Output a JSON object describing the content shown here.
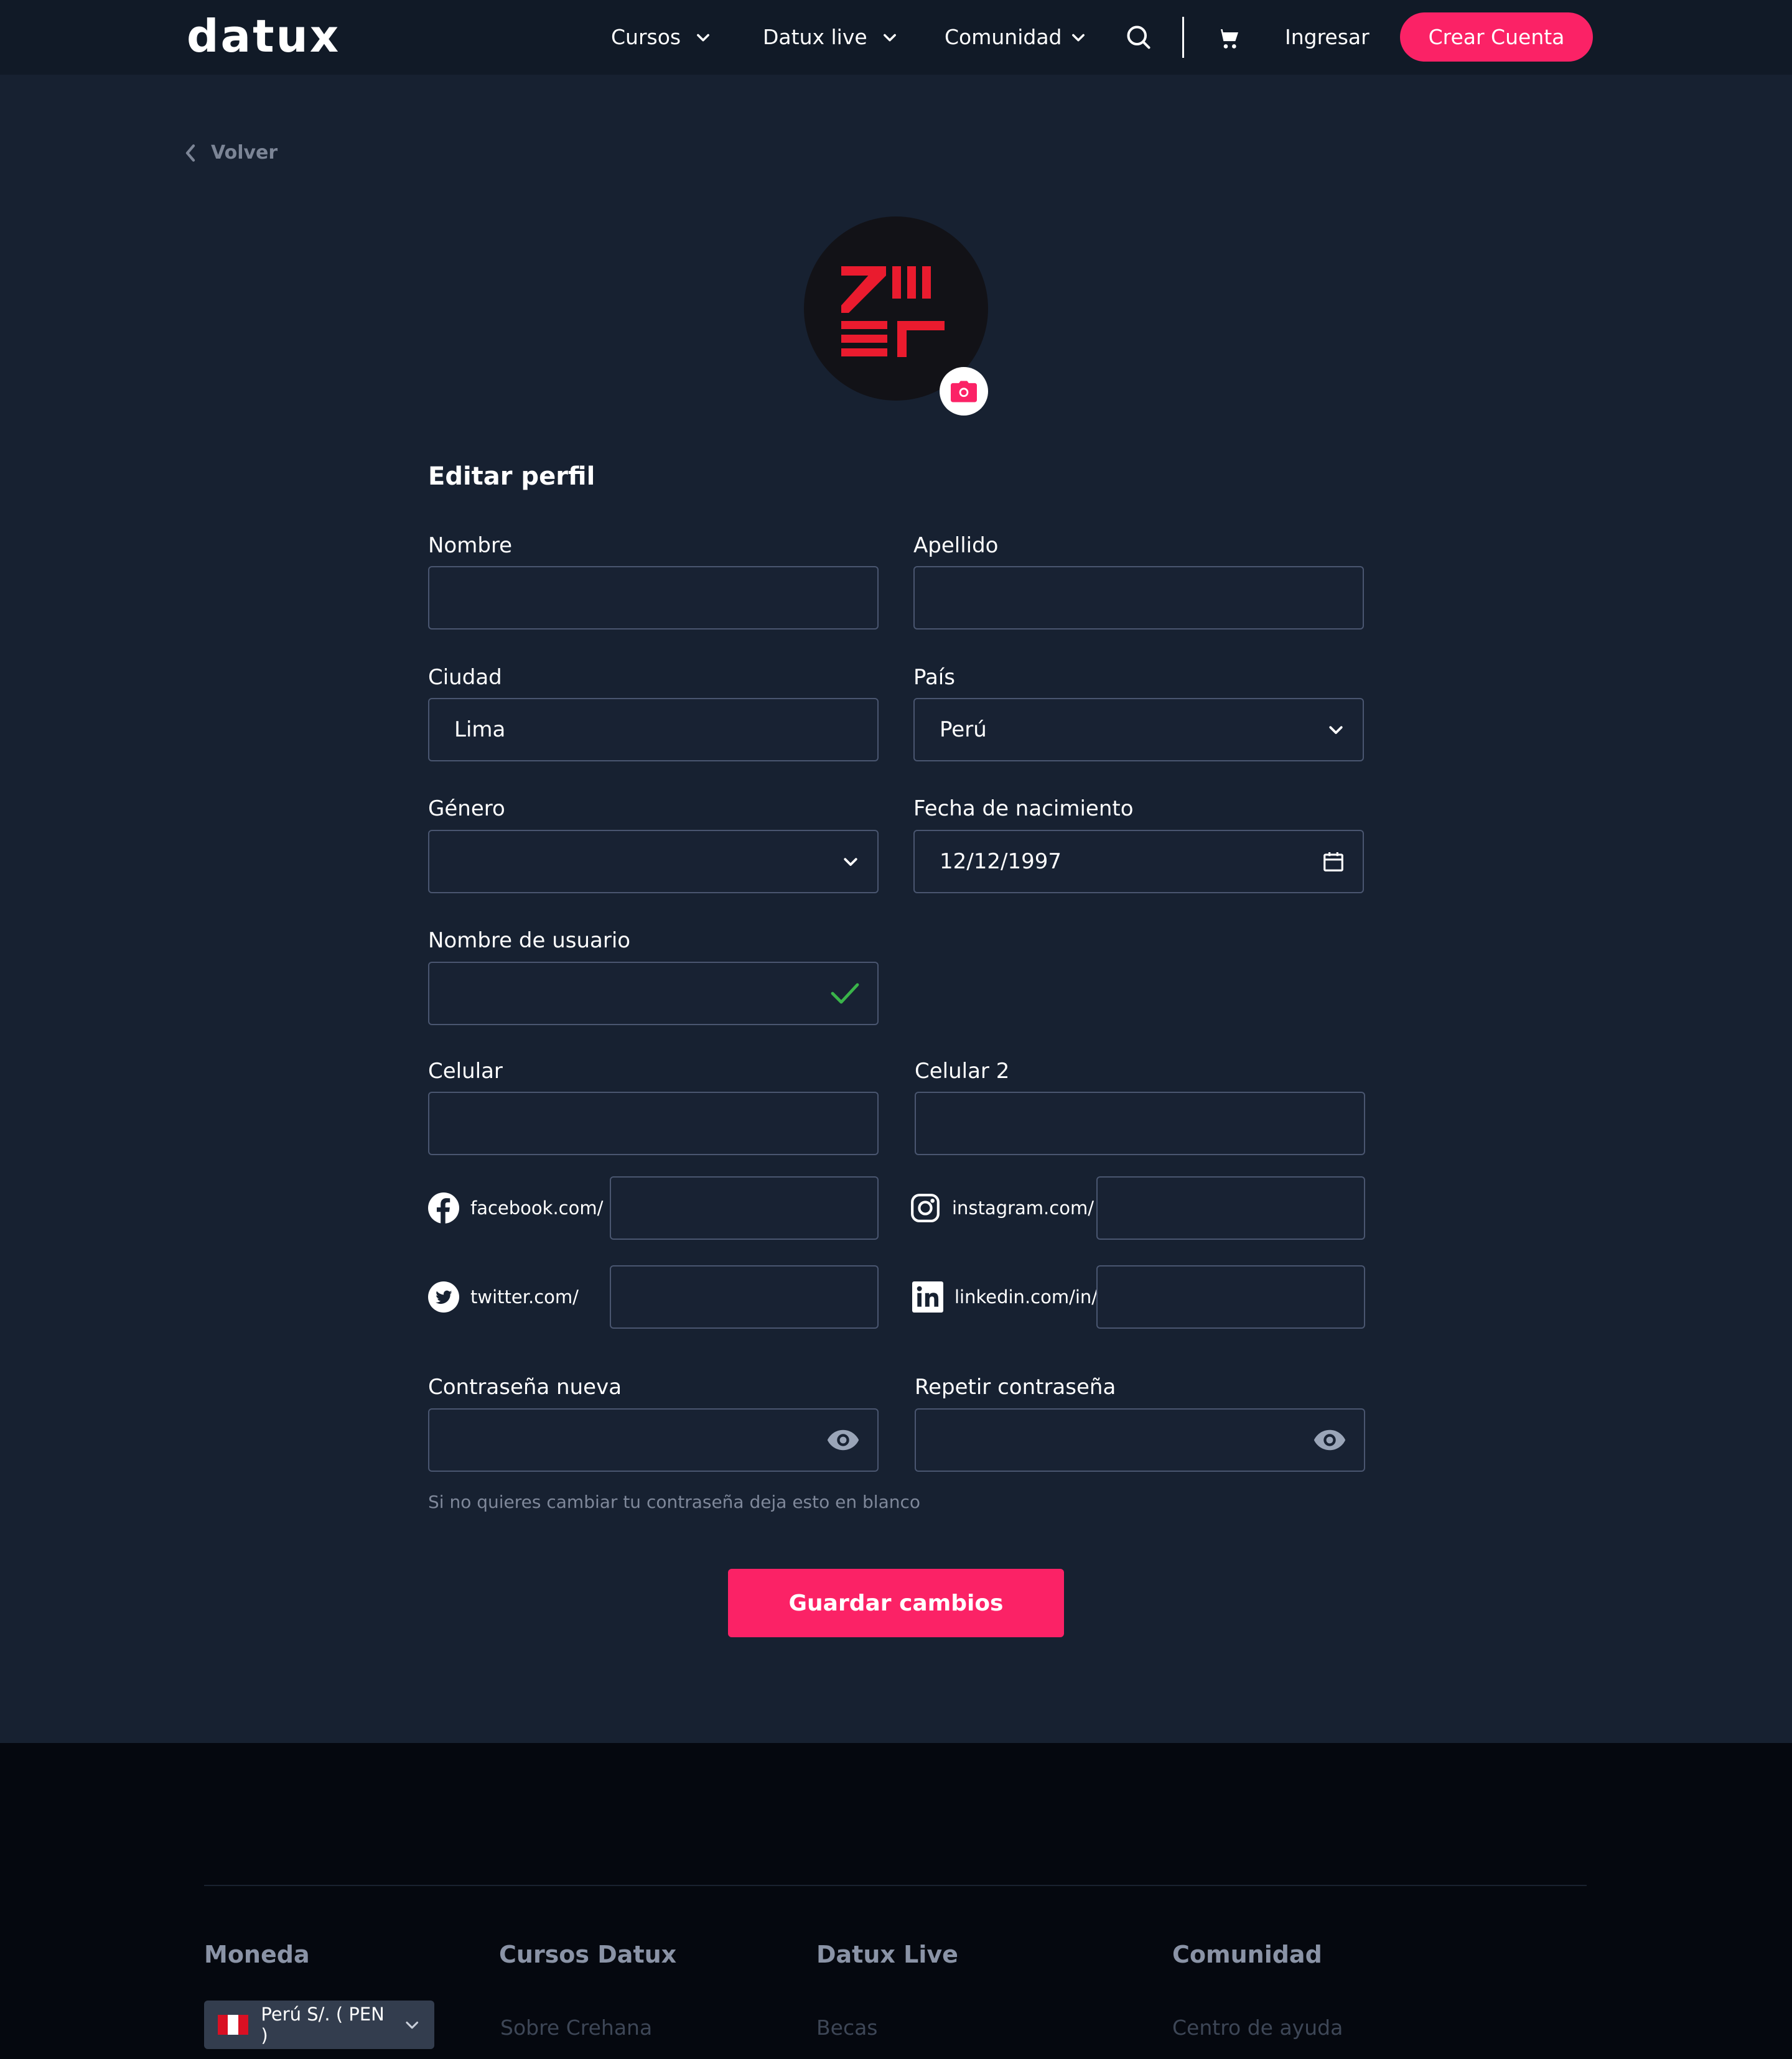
{
  "header": {
    "logo": "datux",
    "nav": [
      {
        "label": "Cursos"
      },
      {
        "label": "Datux live"
      },
      {
        "label": "Comunidad"
      }
    ],
    "login_label": "Ingresar",
    "signup_label": "Crear Cuenta",
    "icons": [
      "search-icon",
      "cart-icon",
      "chevron-down-icon"
    ]
  },
  "back_label": "Volver",
  "form": {
    "title": "Editar perfil",
    "nombre": {
      "label": "Nombre",
      "value": ""
    },
    "apellido": {
      "label": "Apellido",
      "value": ""
    },
    "ciudad": {
      "label": "Ciudad",
      "value": "Lima"
    },
    "pais": {
      "label": "País",
      "value": "Perú"
    },
    "genero": {
      "label": "Género",
      "value": ""
    },
    "fecha": {
      "label": "Fecha de nacimiento",
      "value": "12/12/1997"
    },
    "usuario": {
      "label": "Nombre de usuario",
      "value": ""
    },
    "celular": {
      "label": "Celular",
      "value": ""
    },
    "celular2": {
      "label": "Celular 2",
      "value": ""
    },
    "social": {
      "facebook": {
        "prefix": "facebook.com/",
        "value": ""
      },
      "instagram": {
        "prefix": "instagram.com/",
        "value": ""
      },
      "twitter": {
        "prefix": "twitter.com/",
        "value": ""
      },
      "linkedin": {
        "prefix": "linkedin.com/in/",
        "value": ""
      }
    },
    "password": {
      "label": "Contraseña nueva",
      "value": ""
    },
    "password_repeat": {
      "label": "Repetir contraseña",
      "value": ""
    },
    "password_hint": "Si no quieres cambiar tu contraseña deja esto en blanco",
    "save_label": "Guardar cambios"
  },
  "footer": {
    "columns": [
      {
        "heading": "Moneda"
      },
      {
        "heading": "Cursos Datux",
        "link": "Sobre Crehana"
      },
      {
        "heading": "Datux Live",
        "link": "Becas"
      },
      {
        "heading": "Comunidad",
        "link": "Centro de ayuda"
      }
    ],
    "currency": "Perú S/. ( PEN )"
  },
  "colors": {
    "background": "#172131",
    "header": "#111a27",
    "accent": "#fb2266",
    "field_border": "#4a5670",
    "success": "#3ab44a",
    "footer": "#05080f"
  }
}
